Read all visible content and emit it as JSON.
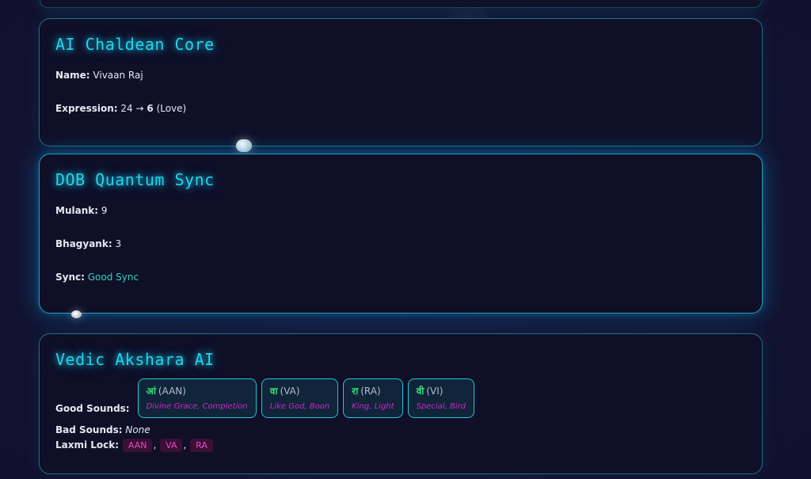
{
  "chaldean": {
    "title": "AI Chaldean Core",
    "name_label": "Name:",
    "name_value": "Vivaan Raj",
    "expression_label": "Expression:",
    "expression_from": "24 →",
    "expression_to": "6",
    "expression_meaning": "(Love)"
  },
  "dob": {
    "title": "DOB Quantum Sync",
    "mulank_label": "Mulank:",
    "mulank_value": "9",
    "bhagyank_label": "Bhagyank:",
    "bhagyank_value": "3",
    "sync_label": "Sync:",
    "sync_value": "Good Sync"
  },
  "vedic": {
    "title": "Vedic Akshara AI",
    "good_label": "Good Sounds:",
    "sounds": [
      {
        "dev": "आं",
        "roman": "(AAN)",
        "meaning": "Divine Grace, Completion"
      },
      {
        "dev": "वा",
        "roman": "(VA)",
        "meaning": "Like God, Boon"
      },
      {
        "dev": "रा",
        "roman": "(RA)",
        "meaning": "King, Light"
      },
      {
        "dev": "वी",
        "roman": "(VI)",
        "meaning": "Special, Bird"
      }
    ],
    "bad_label": "Bad Sounds:",
    "bad_value": "None",
    "laxmi_label": "Laxmi Lock:",
    "laxmi": [
      "AAN",
      "VA",
      "RA"
    ]
  }
}
